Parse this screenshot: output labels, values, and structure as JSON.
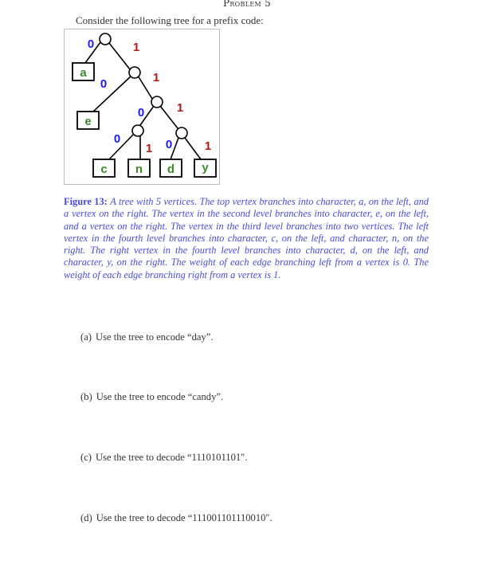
{
  "header": {
    "title": "Problem 5"
  },
  "intro": {
    "text": "Consider the following tree for a prefix code:"
  },
  "figure": {
    "colors": {
      "zero_label": "#1a1aff",
      "one_label": "#b01a1a",
      "leaf_letter": "#3a8a2a",
      "edge": "#000000",
      "caption": "#4a4ad8"
    },
    "edge_labels": {
      "zero": "0",
      "one": "1"
    },
    "leaves": [
      {
        "id": "a",
        "label": "a",
        "code": "0"
      },
      {
        "id": "e",
        "label": "e",
        "code": "10"
      },
      {
        "id": "c",
        "label": "c",
        "code": "1100"
      },
      {
        "id": "n",
        "label": "n",
        "code": "1101"
      },
      {
        "id": "d",
        "label": "d",
        "code": "1110"
      },
      {
        "id": "y",
        "label": "y",
        "code": "1111"
      }
    ],
    "caption_label": "Figure 13:",
    "caption_text": "A tree with 5 vertices. The top vertex branches into character, a, on the left, and a vertex on the right. The vertex in the second level branches into character, e, on the left, and a vertex on the right. The vertex in the third level branches into two vertices. The left vertex in the fourth level branches into character, c, on the left, and character, n, on the right. The right vertex in the fourth level branches into character, d, on the left, and character, y, on the right. The weight of each edge branching left from a vertex is 0. The weight of each edge branching right from a vertex is 1."
  },
  "questions": [
    {
      "label": "(a)",
      "text": "Use the tree to encode “day”."
    },
    {
      "label": "(b)",
      "text": "Use the tree to encode “candy”."
    },
    {
      "label": "(c)",
      "text": "Use the tree to decode “1110101101″."
    },
    {
      "label": "(d)",
      "text": "Use the tree to decode “111001101110010″."
    }
  ]
}
